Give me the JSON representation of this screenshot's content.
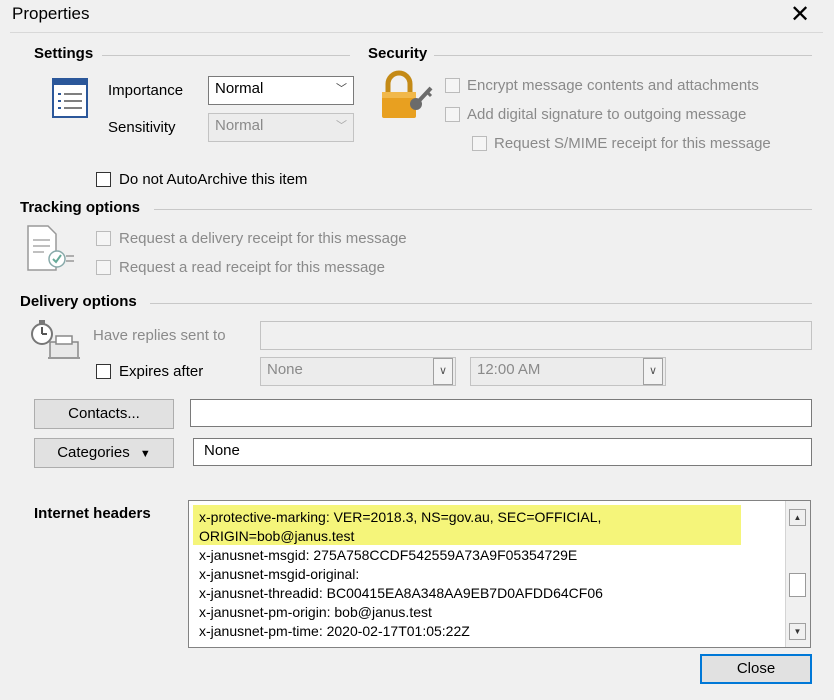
{
  "window": {
    "title": "Properties",
    "close_glyph": "✕"
  },
  "settings": {
    "heading": "Settings",
    "importance_label": "Importance",
    "importance_value": "Normal",
    "sensitivity_label": "Sensitivity",
    "sensitivity_value": "Normal",
    "autoarchive_label": "Do not AutoArchive this item"
  },
  "security": {
    "heading": "Security",
    "encrypt_label": "Encrypt message contents and attachments",
    "signature_label": "Add digital signature to outgoing message",
    "smime_label": "Request S/MIME receipt for this message"
  },
  "tracking": {
    "heading": "Tracking options",
    "delivery_receipt_label": "Request a delivery receipt for this message",
    "read_receipt_label": "Request a read receipt for this message"
  },
  "delivery": {
    "heading": "Delivery options",
    "replies_label": "Have replies sent to",
    "expires_label": "Expires after",
    "expires_date": "None",
    "expires_time": "12:00 AM"
  },
  "contacts": {
    "button_label": "Contacts...",
    "value": ""
  },
  "categories": {
    "button_label": "Categories",
    "value": "None"
  },
  "internet_headers": {
    "label": "Internet headers",
    "lines": [
      "x-protective-marking: VER=2018.3, NS=gov.au, SEC=OFFICIAL,",
      " ORIGIN=bob@janus.test",
      "x-janusnet-msgid: 275A758CCDF542559A73A9F05354729E",
      "x-janusnet-msgid-original:",
      "x-janusnet-threadid: BC00415EA8A348AA9EB7D0AFDD64CF06",
      "x-janusnet-pm-origin: bob@janus.test",
      "x-janusnet-pm-time: 2020-02-17T01:05:22Z"
    ]
  },
  "footer": {
    "close_label": "Close"
  },
  "colors": {
    "highlight": "#f5f57a",
    "lock": "#e8a020",
    "accent": "#0078d7"
  }
}
